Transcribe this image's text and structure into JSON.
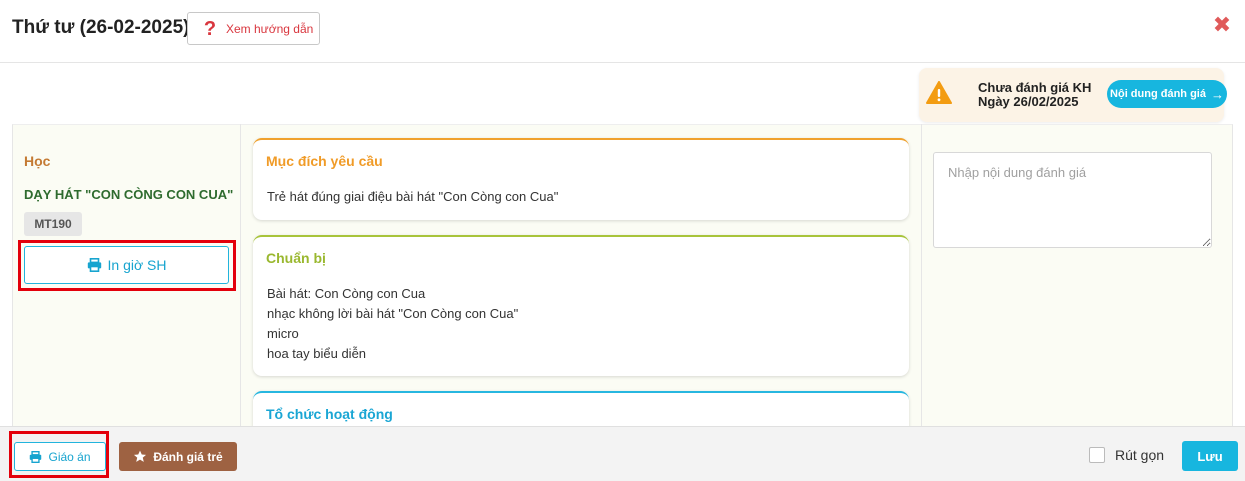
{
  "header": {
    "title": "Thứ tư (26-02-2025)",
    "guide_button": "Xem hướng dẫn",
    "guide_icon": "question-mark-icon",
    "close_icon": "close-icon"
  },
  "status": {
    "line1": "Chưa đánh giá KH",
    "line2": "Ngày 26/02/2025",
    "button": "Nội dung đánh giá",
    "arrow": "→",
    "warning_color": "#f39c12"
  },
  "left": {
    "label": "Học",
    "song": "DẠY HÁT \"CON CÒNG CON CUA\"",
    "code": "MT190",
    "print_button": "In giờ SH"
  },
  "cards": [
    {
      "title": "Mục đích yêu cầu",
      "lines": [
        "Trẻ hát đúng giai điệu bài hát \"Con Còng con Cua\""
      ]
    },
    {
      "title": "Chuẩn bị",
      "lines": [
        "Bài hát: Con Còng con Cua",
        "nhạc không lời bài hát \"Con Còng con Cua\"",
        "micro",
        "hoa tay biểu diễn"
      ]
    },
    {
      "title": "Tổ chức hoạt động",
      "lines": []
    }
  ],
  "evaluation": {
    "placeholder": "Nhập nội dung đánh giá",
    "value": ""
  },
  "footer": {
    "lesson_button": "Giáo án",
    "rate_button": "Đánh giá trẻ",
    "collapse_label": "Rút gọn",
    "save_button": "Lưu"
  },
  "colors": {
    "accent": "#17b6df",
    "brown": "#9e6242",
    "orange": "#f09b27",
    "green": "#9ab82f",
    "highlight": "#e3000b"
  }
}
